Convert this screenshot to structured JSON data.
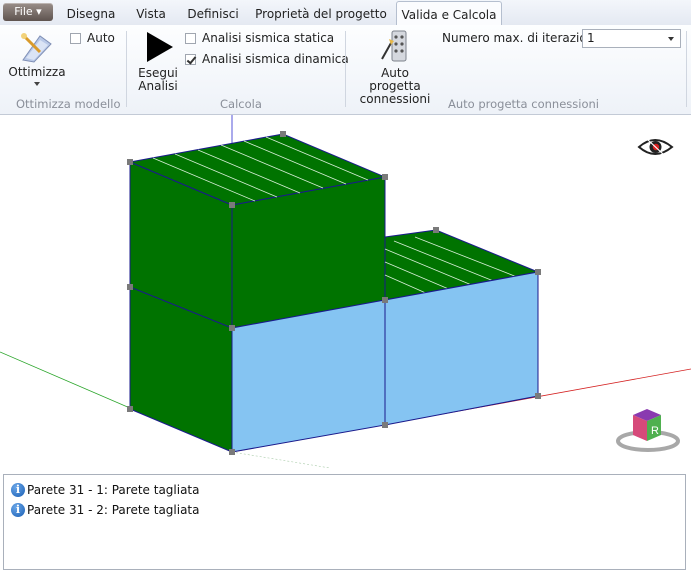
{
  "file_menu": {
    "label": "File"
  },
  "tabs": [
    {
      "label": "Disegna"
    },
    {
      "label": "Vista"
    },
    {
      "label": "Definisci"
    },
    {
      "label": "Proprietà del progetto"
    },
    {
      "label": "Valida e Calcola"
    }
  ],
  "ribbon": {
    "ottimizza": {
      "label": "Ottimizza",
      "auto_label": "Auto",
      "auto_checked": false,
      "group_label": "Ottimizza modello"
    },
    "calcola": {
      "esegui_line1": "Esegui",
      "esegui_line2": "Analisi",
      "static_label": "Analisi sismica statica",
      "static_checked": false,
      "dynamic_label": "Analisi sismica dinamica",
      "dynamic_checked": true,
      "group_label": "Calcola"
    },
    "connessioni": {
      "button_line1": "Auto progetta",
      "button_line2": "connessioni",
      "iterations_label": "Numero max. di iterazioni",
      "iterations_value": "1",
      "group_label": "Auto progetta connessioni"
    }
  },
  "viewport": {
    "nav_cube_label": "R",
    "colors": {
      "green": "#007300",
      "blue": "#85c4f2",
      "edge": "#1a1a8c"
    }
  },
  "messages": [
    {
      "text": "Parete 31 - 1: Parete tagliata"
    },
    {
      "text": "Parete 31 - 2: Parete tagliata"
    }
  ]
}
